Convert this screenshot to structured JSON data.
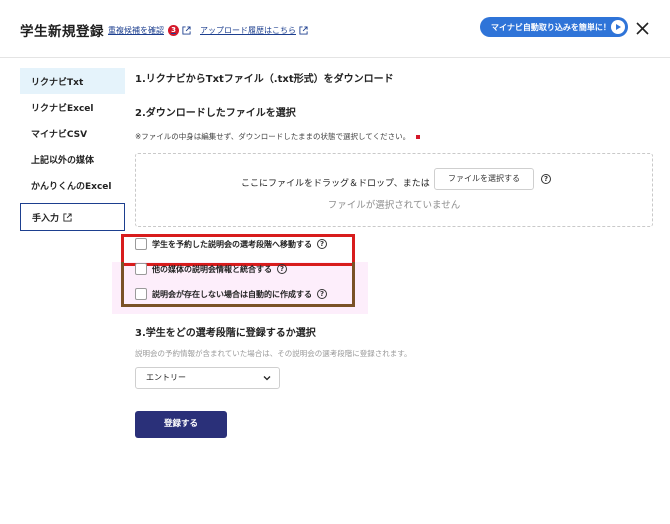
{
  "header": {
    "title": "学生新規登録",
    "link_candidates": "重複候補を確認",
    "badge_count": "3",
    "link_history": "アップロード履歴はこちら",
    "promo_label": "マイナビ自動取り込みを簡単に！"
  },
  "sidebar": {
    "items": [
      {
        "label": "リクナビTxt"
      },
      {
        "label": "リクナビExcel"
      },
      {
        "label": "マイナビCSV"
      },
      {
        "label": "上記以外の媒体"
      },
      {
        "label": "かんりくんのExcel"
      },
      {
        "label": "手入力"
      }
    ]
  },
  "steps": {
    "step1": "1.リクナビからTxtファイル（.txt形式）をダウンロード",
    "step2": "2.ダウンロードしたファイルを選択",
    "step2_note": "※ファイルの中身は編集せず、ダウンロードしたままの状態で選択してください。",
    "step3": "3.学生をどの選考段階に登録するか選択",
    "step3_note": "説明会の予約情報が含まれていた場合は、その説明会の選考段階に登録されます。"
  },
  "dropzone": {
    "prompt": "ここにファイルをドラッグ＆ドロップ、または",
    "button_label": "ファイルを選択する",
    "status": "ファイルが選択されていません"
  },
  "options": [
    {
      "label": "学生を予約した説明会の選考段階へ移動する",
      "checked": false
    },
    {
      "label": "他の媒体の説明会情報と統合する",
      "checked": false
    },
    {
      "label": "説明会が存在しない場合は自動的に作成する",
      "checked": false
    }
  ],
  "stage_select": {
    "value": "エントリー"
  },
  "submit_label": "登録する",
  "colors": {
    "accent_navy": "#2a3079",
    "link_blue": "#1d3f8f",
    "promo_blue": "#2f74d8",
    "badge_red": "#d4172a",
    "active_tab_bg": "#e5f3fb"
  }
}
